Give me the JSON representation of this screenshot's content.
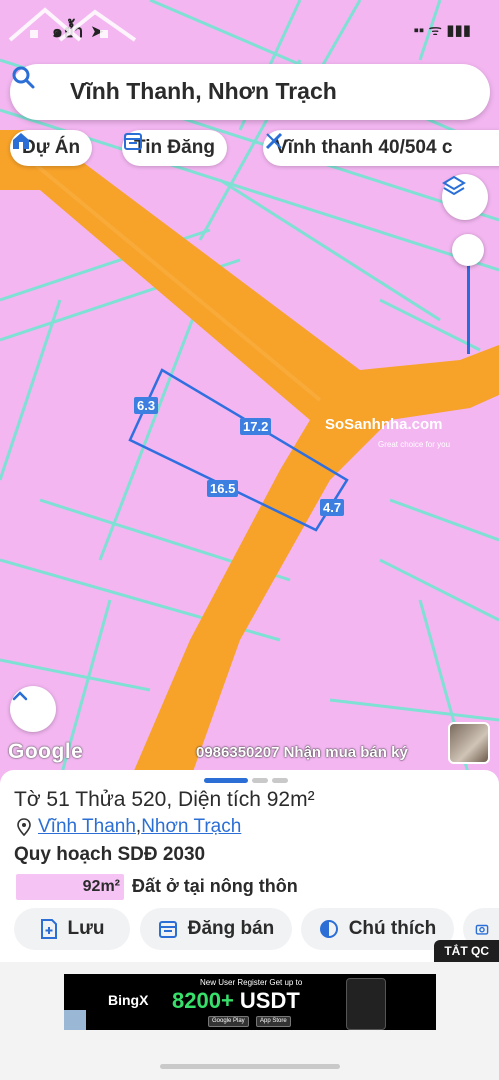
{
  "status_bar": {
    "carrier": "๑ย้ำ ➤",
    "icons": "▪▪ ᯤ ▮▮▮"
  },
  "search": {
    "text": "Vĩnh Thanh, Nhơn Trạch",
    "icon": "search-icon"
  },
  "chips": [
    {
      "label": "Dự Án",
      "icon": "house-icon"
    },
    {
      "label": "Tin Đăng",
      "icon": "calendar-icon"
    },
    {
      "label": "Vĩnh thanh 40/504 c",
      "icon": "ruler-icon"
    }
  ],
  "map": {
    "dimensions": [
      "6.3",
      "17.2",
      "16.5",
      "4.7"
    ],
    "watermark": {
      "brand": "SoSanhnha.com",
      "tagline": "Great choice for you"
    },
    "google": "Google",
    "marquee": "0986350207 Nhận mua bán ký"
  },
  "sheet": {
    "title": "Tờ 51 Thửa 520, Diện tích 92m²",
    "location": {
      "commune": "Vĩnh Thanh",
      "separator": ", ",
      "district": "Nhơn Trạch"
    },
    "plan_title": "Quy hoạch SDĐ 2030",
    "area": "92m²",
    "area_desc": "Đất ở tại nông thôn",
    "actions": [
      {
        "label": "Lưu",
        "icon": "add-document-icon"
      },
      {
        "label": "Đăng bán",
        "icon": "calendar-icon"
      },
      {
        "label": "Chú thích",
        "icon": "half-circle-icon"
      }
    ]
  },
  "ad": {
    "close_label": "TẮT QC",
    "brand": "BingX",
    "headline_top": "New User Register Get up to",
    "amount": "8200+",
    "currency": "USDT",
    "store1": "Google Play",
    "store2": "App Store"
  },
  "colors": {
    "parcel": "#f3b6f1",
    "road": "#f7a229",
    "boundary": "#7fe0d4",
    "accent": "#2b6fd6"
  }
}
